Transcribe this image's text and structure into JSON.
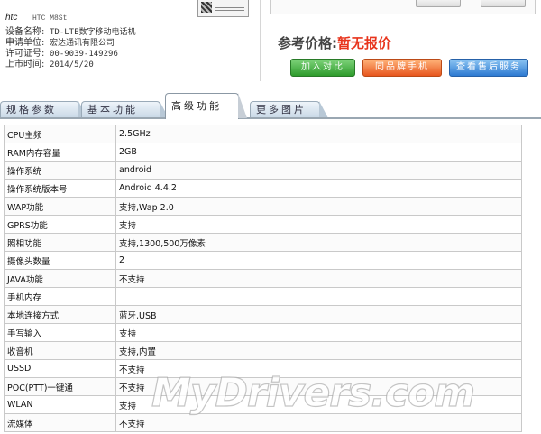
{
  "device": {
    "brand": "htc",
    "model": "HTC M8St",
    "rows": [
      {
        "label": "设备名称:",
        "value": "TD-LTE数字移动电话机"
      },
      {
        "label": "申请单位:",
        "value": "宏达通讯有限公司"
      },
      {
        "label": "许可证号:",
        "value": "00-9039-149296"
      },
      {
        "label": "上市时间:",
        "value": "2014/5/20"
      }
    ]
  },
  "price": {
    "label": "参考价格:",
    "value": "暂无报价"
  },
  "actions": {
    "compare": "加入对比",
    "same_brand": "同品牌手机",
    "other_service": "查看售后服务"
  },
  "tabs": [
    {
      "label": "规格参数",
      "active": false
    },
    {
      "label": "基本功能",
      "active": false
    },
    {
      "label": "高级功能",
      "active": true
    },
    {
      "label": "更多图片",
      "active": false
    }
  ],
  "specs": [
    {
      "name": "CPU主频",
      "value": "2.5GHz"
    },
    {
      "name": "RAM内存容量",
      "value": "2GB"
    },
    {
      "name": "操作系统",
      "value": "android"
    },
    {
      "name": "操作系统版本号",
      "value": "Android 4.4.2"
    },
    {
      "name": "WAP功能",
      "value": "支持,Wap 2.0"
    },
    {
      "name": "GPRS功能",
      "value": "支持"
    },
    {
      "name": "照相功能",
      "value": "支持,1300,500万像素"
    },
    {
      "name": "摄像头数量",
      "value": "2"
    },
    {
      "name": "JAVA功能",
      "value": "不支持"
    },
    {
      "name": "手机内存",
      "value": ""
    },
    {
      "name": "本地连接方式",
      "value": "蓝牙,USB"
    },
    {
      "name": "手写输入",
      "value": "支持"
    },
    {
      "name": "收音机",
      "value": "支持,内置"
    },
    {
      "name": "USSD",
      "value": "不支持"
    },
    {
      "name": "POC(PTT)一键通",
      "value": "不支持"
    },
    {
      "name": "WLAN",
      "value": "支持"
    },
    {
      "name": "流媒体",
      "value": "不支持"
    }
  ],
  "watermark": "MyDrivers.com"
}
